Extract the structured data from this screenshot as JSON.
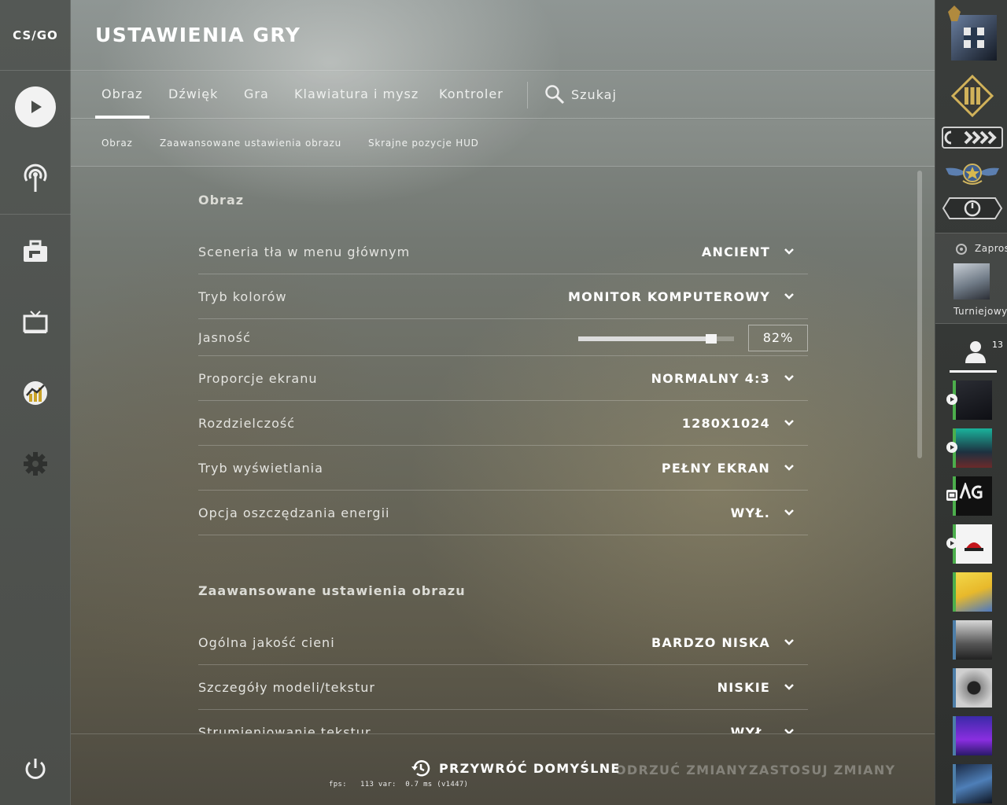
{
  "app": {
    "logo_text": "CS/GO",
    "page_title": "USTAWIENIA GRY"
  },
  "leftnav": {
    "items": [
      {
        "icon": "play-icon"
      },
      {
        "icon": "broadcast-icon"
      },
      {
        "icon": "inventory-briefcase-icon"
      },
      {
        "icon": "watch-tv-icon"
      },
      {
        "icon": "stats-chart-icon"
      },
      {
        "icon": "settings-gear-icon"
      },
      {
        "icon": "power-icon"
      }
    ]
  },
  "tabs": {
    "items": [
      "Obraz",
      "Dźwięk",
      "Gra",
      "Klawiatura i mysz",
      "Kontroler"
    ],
    "active": "Obraz",
    "search_label": "Szukaj"
  },
  "subtabs": {
    "items": [
      "Obraz",
      "Zaawansowane ustawienia obrazu",
      "Skrajne pozycje HUD"
    ]
  },
  "sections": {
    "video": {
      "title": "Obraz",
      "rows": [
        {
          "label": "Sceneria tła w menu głównym",
          "value": "ANCIENT"
        },
        {
          "label": "Tryb kolorów",
          "value": "MONITOR KOMPUTEROWY"
        },
        {
          "label": "Jasność",
          "value": "82%",
          "slider_fraction": 0.82
        },
        {
          "label": "Proporcje ekranu",
          "value": "NORMALNY 4:3"
        },
        {
          "label": "Rozdzielczość",
          "value": "1280X1024"
        },
        {
          "label": "Tryb wyświetlania",
          "value": "PEŁNY EKRAN"
        },
        {
          "label": "Opcja oszczędzania energii",
          "value": "WYŁ."
        }
      ]
    },
    "advanced": {
      "title": "Zaawansowane ustawienia obrazu",
      "rows": [
        {
          "label": "Ogólna jakość cieni",
          "value": "BARDZO NISKA"
        },
        {
          "label": "Szczegóły modeli/tekstur",
          "value": "NISKIE"
        },
        {
          "label": "Strumieniowanie tekstur",
          "value": "WYŁ."
        }
      ]
    }
  },
  "footer": {
    "restore": "PRZYWRÓĆ DOMYŚLNE",
    "discard": "ODRZUĆ ZMIANY",
    "apply": "ZASTOSUJ ZMIANY",
    "fps_text": "fps:   113 var:  0.7 ms (v1447)"
  },
  "rightpanel": {
    "invite_label": "Zapros",
    "invite_name": "Turniejowy",
    "friends_count": "13",
    "colors": {
      "online": "#4cae4c",
      "offline": "#4d7ea8"
    }
  }
}
